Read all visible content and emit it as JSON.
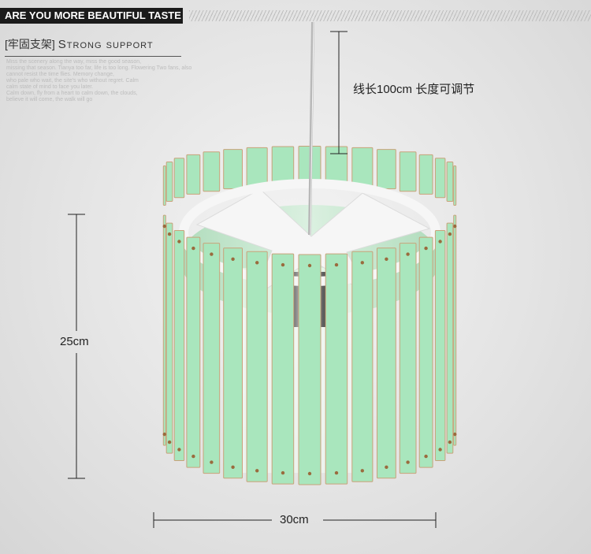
{
  "banner": {
    "title": "ARE YOU MORE BEAUTIFUL TASTE"
  },
  "section": {
    "title_cn": "[牢固支架]",
    "title_en": "Strong support",
    "body": "Miss the scenery along the way, miss the good season,\nmissing that season. Tianya too far, life is too long. Flowering Two fans, also\ncannot resist the time flies. Memory change,\nwho pale who wait, the site's who without regret. Calm\ncalm state of mind to face you later.\nCalm down, fly from a heart to calm down, the clouds,\nbelieve it will come, the walk will go"
  },
  "dimensions": {
    "cord": "线长100cm 长度可调节",
    "height": "25cm",
    "width": "30cm"
  },
  "colors": {
    "slat": "#a9e6bd",
    "slat_edge": "#c9a27a",
    "frame": "#f6f6f6",
    "banner_bg": "#1b1b1b"
  }
}
